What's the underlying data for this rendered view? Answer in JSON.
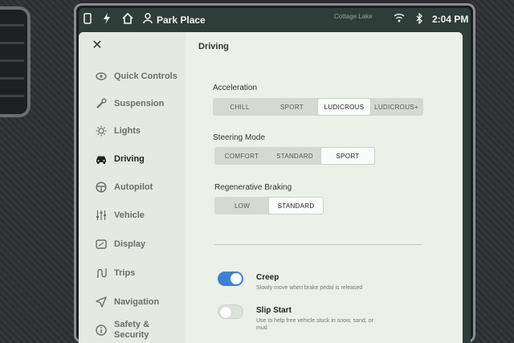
{
  "status_bar": {
    "location": "Park Place",
    "map_label": "Cottage Lake",
    "time": "2:04 PM"
  },
  "sidebar": {
    "items": [
      {
        "label": "Quick Controls",
        "icon": "eye-icon"
      },
      {
        "label": "Suspension",
        "icon": "wrench-icon"
      },
      {
        "label": "Lights",
        "icon": "sun-icon"
      },
      {
        "label": "Driving",
        "icon": "car-icon",
        "active": true
      },
      {
        "label": "Autopilot",
        "icon": "steering-wheel-icon"
      },
      {
        "label": "Vehicle",
        "icon": "sliders-icon"
      },
      {
        "label": "Display",
        "icon": "display-icon"
      },
      {
        "label": "Trips",
        "icon": "trips-icon"
      },
      {
        "label": "Navigation",
        "icon": "navigation-arrow-icon"
      },
      {
        "label": "Safety & Security",
        "icon": "info-icon"
      }
    ]
  },
  "content": {
    "title": "Driving",
    "acceleration": {
      "label": "Acceleration",
      "options": [
        "CHILL",
        "SPORT",
        "LUDICROUS",
        "LUDICROUS+"
      ],
      "selected": "LUDICROUS"
    },
    "steering_mode": {
      "label": "Steering Mode",
      "options": [
        "COMFORT",
        "STANDARD",
        "SPORT"
      ],
      "selected": "SPORT"
    },
    "regenerative_braking": {
      "label": "Regenerative Braking",
      "options": [
        "LOW",
        "STANDARD"
      ],
      "selected": "STANDARD"
    },
    "creep": {
      "title": "Creep",
      "description": "Slowly move when brake pedal is released",
      "enabled": true
    },
    "slip_start": {
      "title": "Slip Start",
      "description": "Use to help free vehicle stuck in snow, sand, or mud",
      "enabled": false
    }
  },
  "colors": {
    "toggle_on": "#3b82d6",
    "panel_bg": "#e9efe6"
  }
}
